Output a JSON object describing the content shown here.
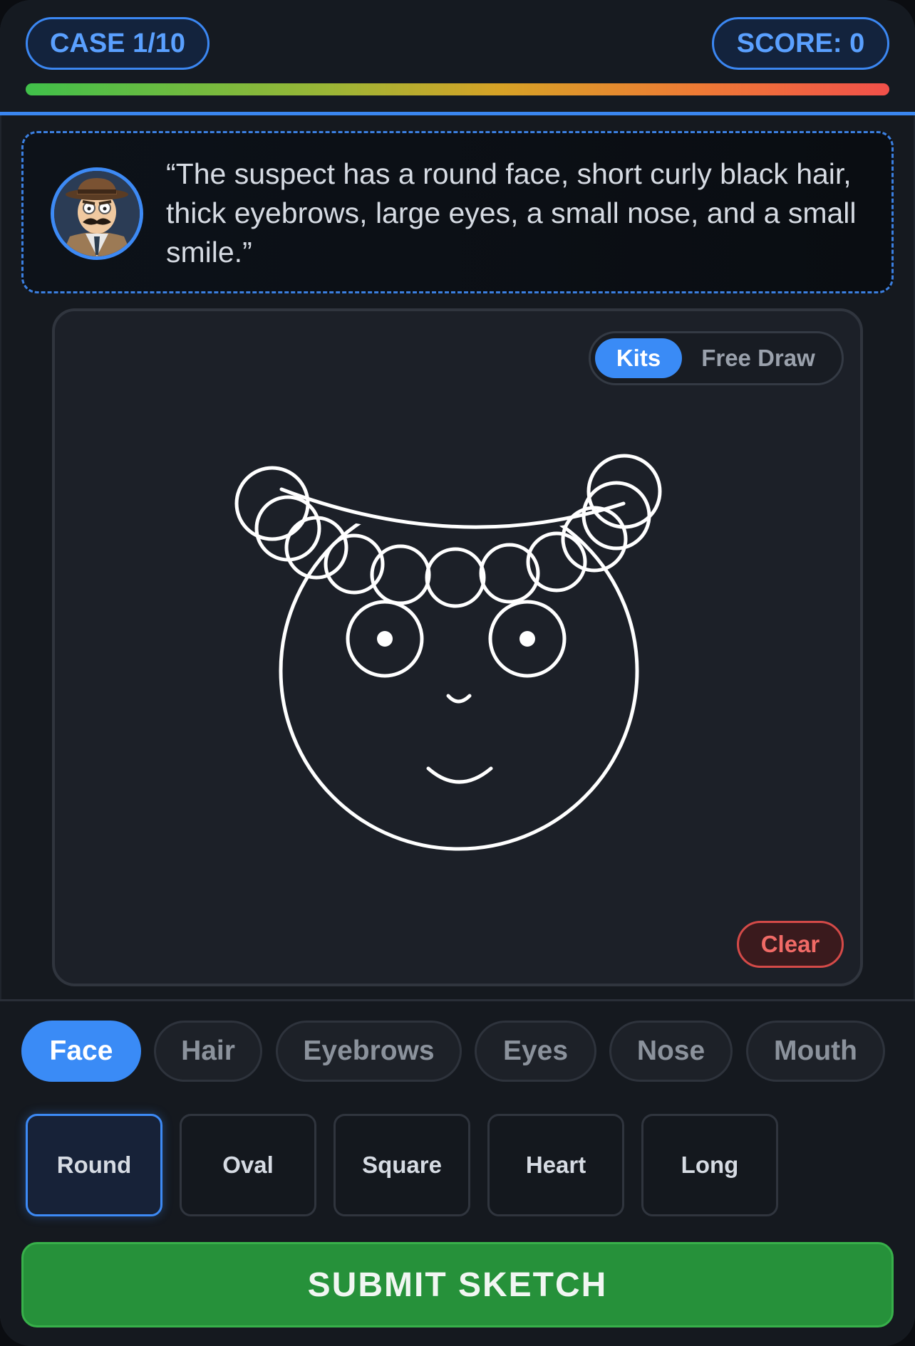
{
  "header": {
    "case_label": "CASE 1/10",
    "score_label": "SCORE: 0",
    "timer_progress_fraction": 1.0
  },
  "witness": {
    "avatar_icon": "detective-avatar-icon",
    "quote": "“The suspect has a round face, short curly black hair, thick eyebrows, large eyes, a small nose, and a small smile.”"
  },
  "canvas": {
    "mode_options": [
      "Kits",
      "Free Draw"
    ],
    "selected_mode": "Kits",
    "clear_label": "Clear",
    "sketch_parts": {
      "face": "Round",
      "hair": "curly",
      "eyes": "large",
      "nose": "small",
      "mouth": "small smile"
    }
  },
  "categories": {
    "tabs": [
      "Face",
      "Hair",
      "Eyebrows",
      "Eyes",
      "Nose",
      "Mouth"
    ],
    "selected": "Face"
  },
  "face_options": {
    "items": [
      "Round",
      "Oval",
      "Square",
      "Heart",
      "Long"
    ],
    "selected": "Round"
  },
  "submit_label": "SUBMIT SKETCH",
  "colors": {
    "accent": "#3a8bf6",
    "submit_green": "#26913a",
    "clear_red": "#f06a66",
    "progress_start": "#40c04a",
    "progress_end": "#f1504a"
  }
}
